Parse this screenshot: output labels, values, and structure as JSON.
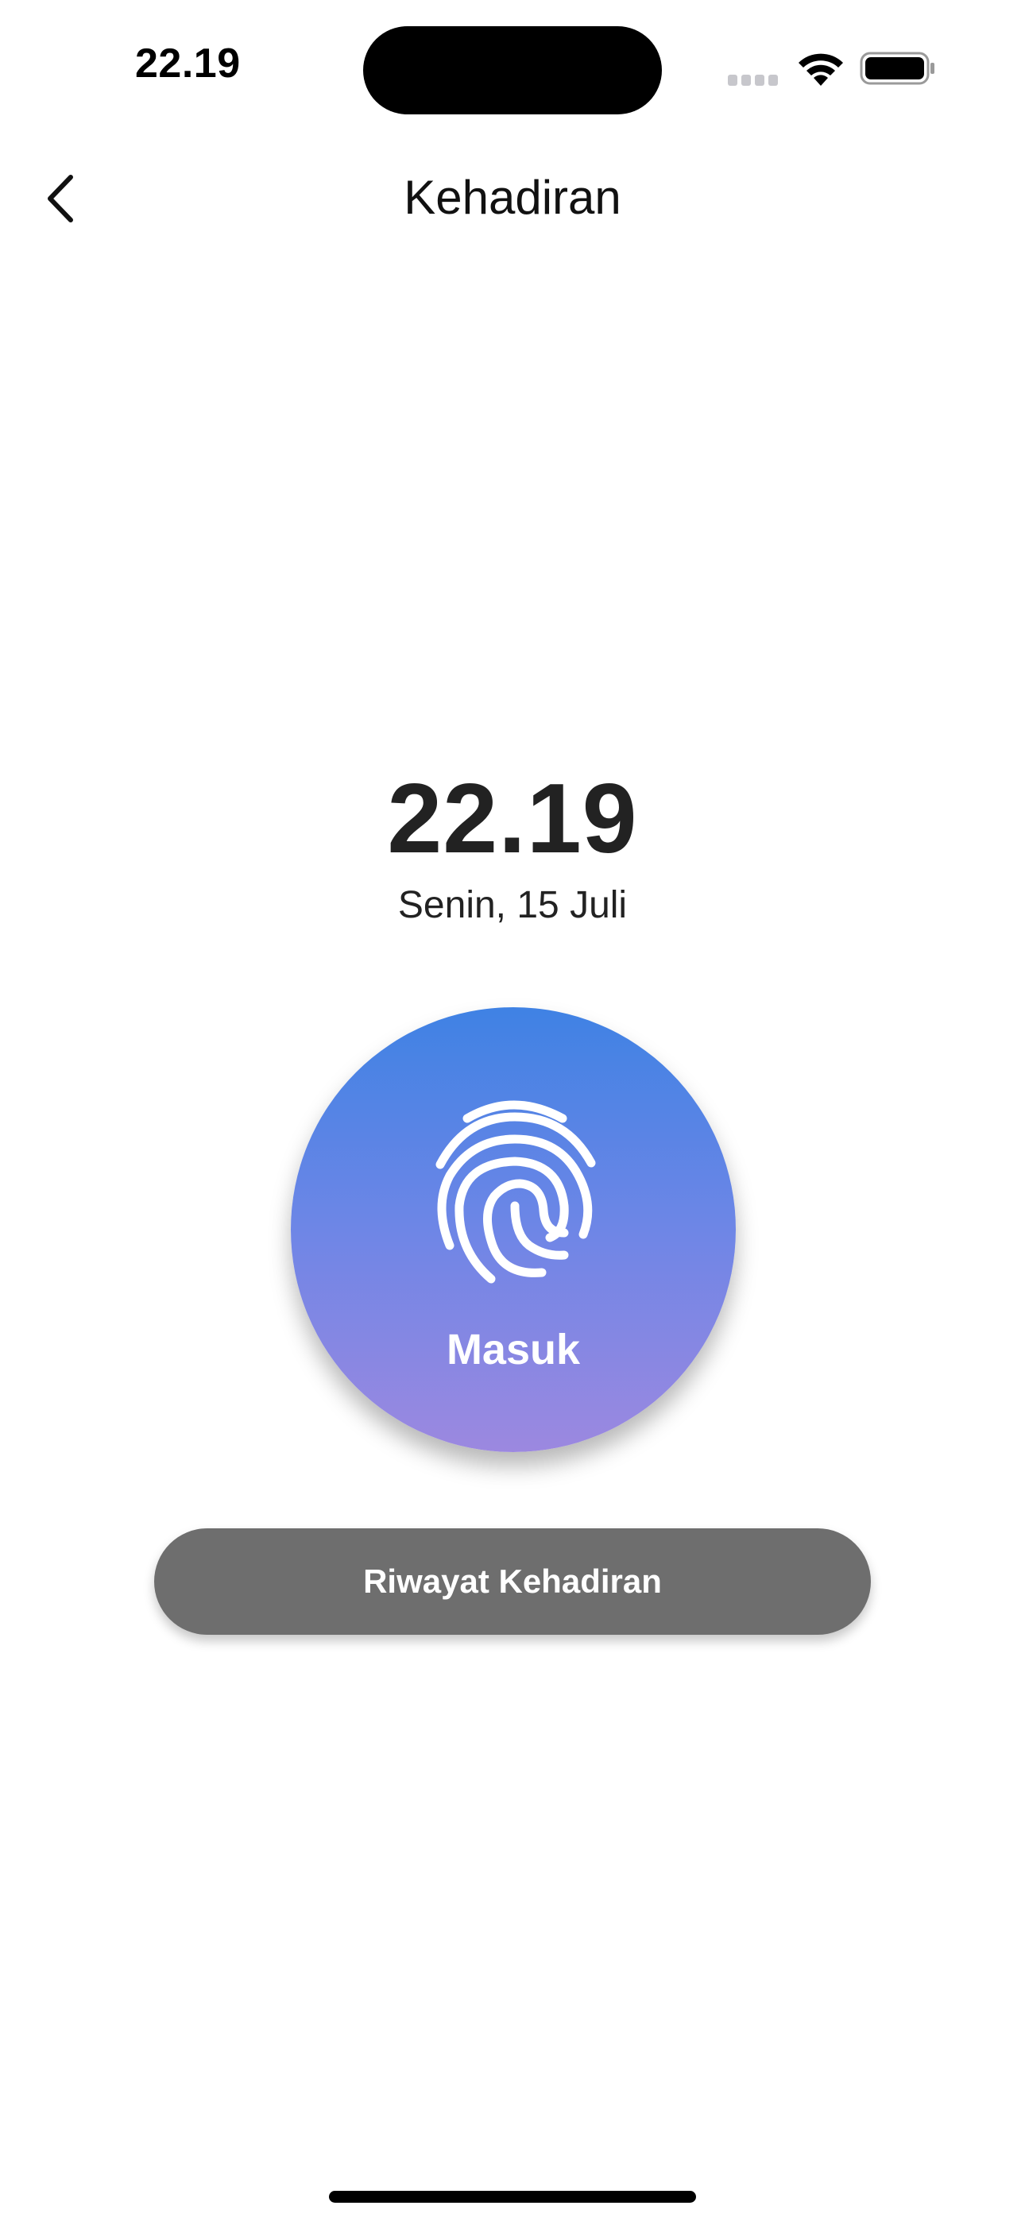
{
  "status_bar": {
    "time": "22.19",
    "icons": [
      "cellular-signal-icon",
      "wifi-icon",
      "battery-icon"
    ]
  },
  "nav": {
    "title": "Kehadiran",
    "back_icon": "chevron-left-icon"
  },
  "clock": {
    "time": "22.19",
    "date": "Senin, 15 Juli"
  },
  "checkin": {
    "icon": "fingerprint-icon",
    "label": "Masuk",
    "gradient_top": "#3f82e4",
    "gradient_bottom": "#9c88e0"
  },
  "history": {
    "label": "Riwayat Kehadiran",
    "color": "#6e6e6e"
  }
}
